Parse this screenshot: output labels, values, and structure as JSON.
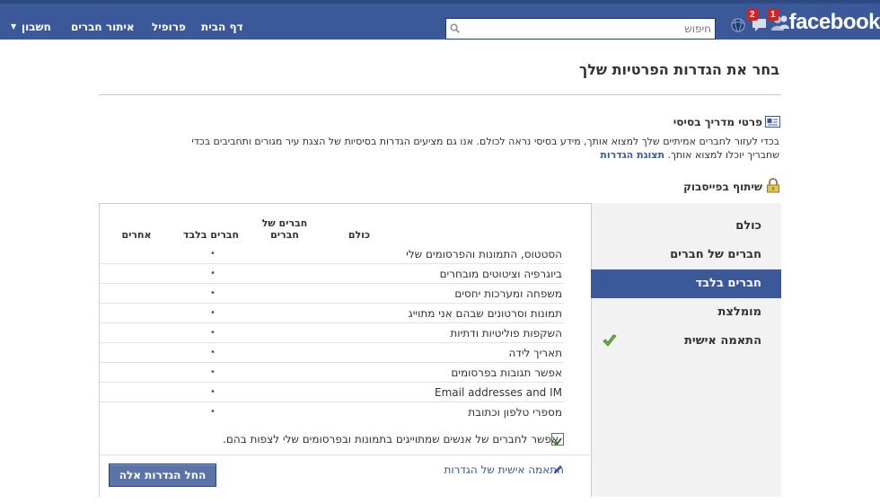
{
  "header": {
    "logo": "facebook",
    "search_placeholder": "חיפוש",
    "badges": {
      "friend_requests": "1",
      "messages": "2"
    },
    "nav": [
      "דף הבית",
      "פרופיל",
      "איתור חברים",
      "חשבון"
    ]
  },
  "page": {
    "title": "בחר את הגדרות הפרטיות שלך"
  },
  "basic": {
    "title": "פרטי מדריך בסיסי",
    "text": "בכדי לעזור לחברים אמיתיים שלך למצוא אותך, מידע בסיסי נראה לכולם. אנו גם מציעים הגדרות בסיסיות של הצגת עיר מגורים ותחביבים בכדי שחבריך יוכלו למצוא אותך.",
    "link": "תצוגת הגדרות"
  },
  "sharing": {
    "title": "שיתוף בפייסבוק",
    "options": [
      "כולם",
      "חברים של חברים",
      "חברים בלבד",
      "מומלצת",
      "התאמה אישית"
    ],
    "selected_index": 2,
    "columns": [
      "כולם",
      "חברים של חברים",
      "חברים בלבד",
      "אחרים"
    ],
    "rows": [
      "הסטטוס, התמונות והפרסומים שלי",
      "ביוגרפיה וציטוטים מובחרים",
      "משפחה ומערכות יחסים",
      "תמונות וסרטונים שבהם אני מתוייג",
      "השקפות פוליטיות ודתיות",
      "תאריך לידה",
      "אפשר תגובות בפרסומים",
      "Email addresses and IM",
      "מספרי טלפון וכתובת"
    ],
    "dot": "•",
    "tag_permission": "אפשר לחברים של אנשים שמתוייגים בתמונות ובפרסומים שלי לצפות בהם.",
    "tag_permission_checked": true,
    "custom_link": "התאמה אישית של הגדרות",
    "apply_button": "החל הגדרות אלה"
  },
  "colors": {
    "brand": "#3b5998",
    "check": "#6cb23e",
    "badge": "#e41b17"
  }
}
